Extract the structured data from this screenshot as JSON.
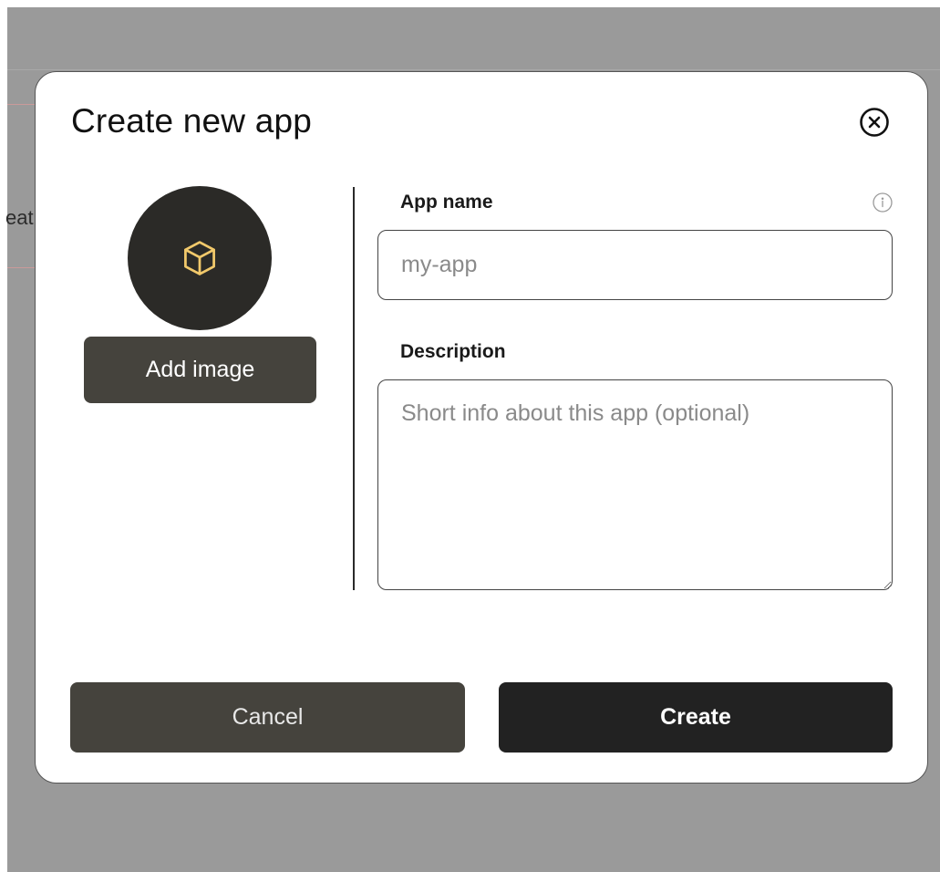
{
  "background": {
    "partial_text": "eat"
  },
  "modal": {
    "title": "Create new app",
    "close_icon": "close-circle-icon",
    "avatar": {
      "icon": "cube-icon",
      "icon_color": "#f2c96b",
      "bg_color": "#2b2a27"
    },
    "add_image_label": "Add image",
    "fields": {
      "app_name": {
        "label": "App name",
        "placeholder": "my-app",
        "value": "",
        "info_icon": "info-icon"
      },
      "description": {
        "label": "Description",
        "placeholder": "Short info about this app (optional)",
        "value": ""
      }
    },
    "buttons": {
      "cancel": "Cancel",
      "create": "Create"
    }
  },
  "colors": {
    "overlay": "#9a9a9a",
    "secondary_button": "#45433d",
    "primary_button": "#222222"
  }
}
